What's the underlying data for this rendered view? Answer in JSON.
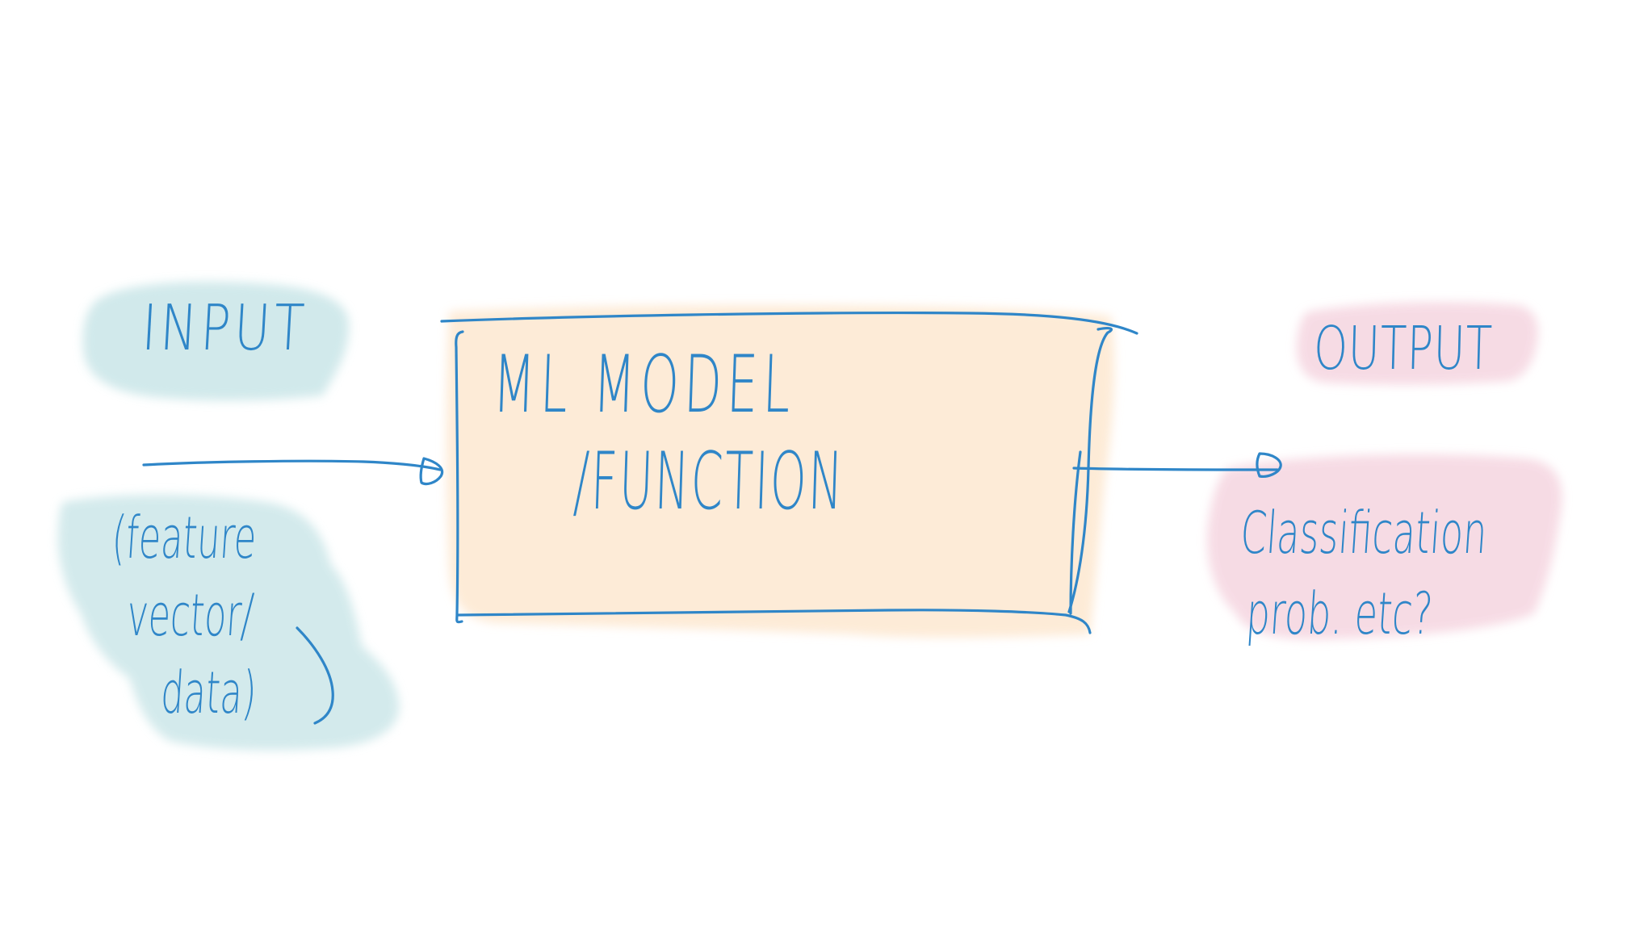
{
  "colors": {
    "ink": "#2f86c8",
    "input_wash": "#cfe8ea",
    "box_wash": "#fde9d3",
    "output_wash": "#f6d8e2",
    "background": "#ffffff"
  },
  "input": {
    "title": "INPUT",
    "detail_lines": [
      "(feature",
      "vector/",
      "data)"
    ]
  },
  "model": {
    "line1": "ML MODEL",
    "line2": "/FUNCTION"
  },
  "output": {
    "title": "OUTPUT",
    "detail_lines": [
      "Classification",
      "prob. etc?"
    ]
  }
}
